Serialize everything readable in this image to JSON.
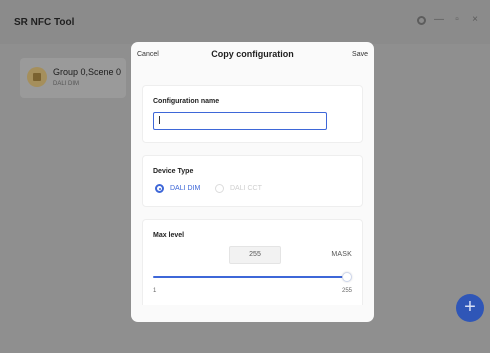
{
  "app": {
    "title": "SR NFC Tool"
  },
  "window_controls": {
    "settings_icon": "gear-icon",
    "minimize": "—",
    "maximize": "▫",
    "close": "×"
  },
  "group_card": {
    "title": "Group 0,Scene 0",
    "subtitle": "DALI DIM",
    "icon": "scene-icon"
  },
  "fab": {
    "label": "+",
    "icon": "plus-icon",
    "color": "#2f56b7"
  },
  "modal": {
    "cancel_label": "Cancel",
    "title": "Copy configuration",
    "save_label": "Save",
    "config_name": {
      "label": "Configuration name",
      "value": ""
    },
    "device_type": {
      "label": "Device Type",
      "options": [
        {
          "label": "DALI DIM",
          "selected": true
        },
        {
          "label": "DALI CCT",
          "selected": false
        }
      ]
    },
    "max_level": {
      "label": "Max level",
      "value": "255",
      "mask_label": "MASK",
      "min": "1",
      "max": "255",
      "slider_fraction": 1.0
    }
  },
  "colors": {
    "accent": "#3e67d8",
    "overlay": "#8f8f8f",
    "modal_bg": "#fafafa"
  }
}
